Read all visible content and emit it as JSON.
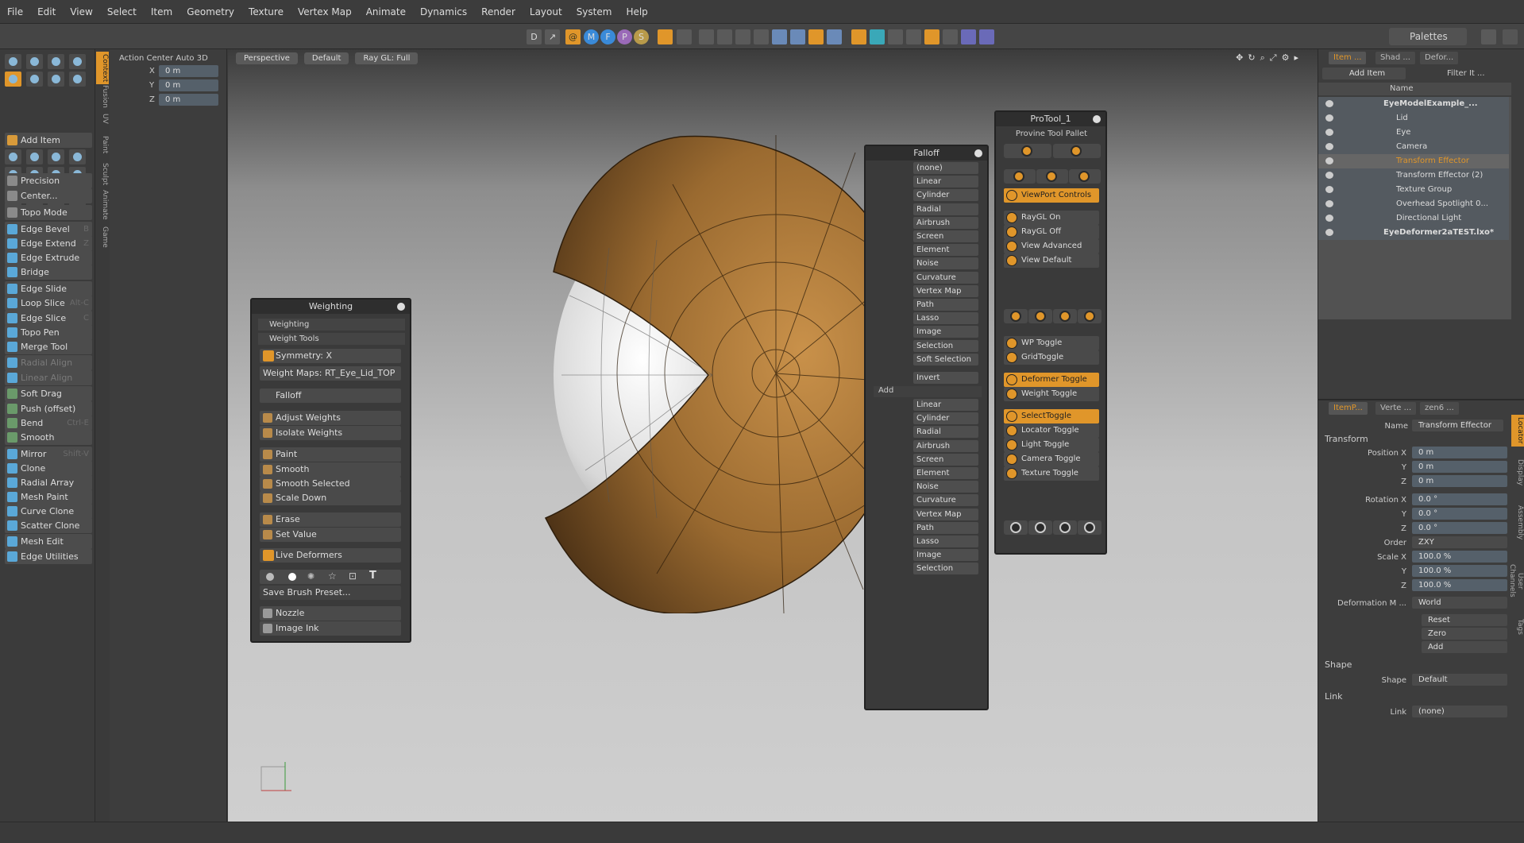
{
  "menu": [
    "File",
    "Edit",
    "View",
    "Select",
    "Item",
    "Geometry",
    "Texture",
    "Vertex Map",
    "Animate",
    "Dynamics",
    "Render",
    "Layout",
    "System",
    "Help"
  ],
  "topbar": {
    "palettes": "Palettes",
    "icons": [
      "D",
      "↗",
      "@",
      "M",
      "F",
      "P",
      "S"
    ]
  },
  "left_tools": {
    "add_item": "Add Item",
    "items": [
      {
        "label": "Precision",
        "shortcut": ""
      },
      {
        "label": "Center...",
        "shortcut": ""
      },
      {
        "label": "Topo Mode",
        "shortcut": ""
      },
      {
        "label": "Edge Bevel",
        "shortcut": "B"
      },
      {
        "label": "Edge Extend",
        "shortcut": "Z"
      },
      {
        "label": "Edge Extrude",
        "shortcut": ""
      },
      {
        "label": "Bridge",
        "shortcut": ""
      },
      {
        "label": "Edge Slide",
        "shortcut": ""
      },
      {
        "label": "Loop Slice",
        "shortcut": "Alt-C"
      },
      {
        "label": "Edge Slice",
        "shortcut": "C"
      },
      {
        "label": "Topo Pen",
        "shortcut": ""
      },
      {
        "label": "Merge Tool",
        "shortcut": ""
      },
      {
        "label": "Radial Align",
        "shortcut": ""
      },
      {
        "label": "Linear Align",
        "shortcut": ""
      },
      {
        "label": "Soft Drag",
        "shortcut": ""
      },
      {
        "label": "Push (offset)",
        "shortcut": ""
      },
      {
        "label": "Bend",
        "shortcut": "Ctrl-E"
      },
      {
        "label": "Smooth",
        "shortcut": ""
      },
      {
        "label": "Mirror",
        "shortcut": "Shift-V"
      },
      {
        "label": "Clone",
        "shortcut": ""
      },
      {
        "label": "Radial Array",
        "shortcut": ""
      },
      {
        "label": "Mesh Paint",
        "shortcut": ""
      },
      {
        "label": "Curve Clone",
        "shortcut": ""
      },
      {
        "label": "Scatter Clone",
        "shortcut": ""
      },
      {
        "label": "Mesh Edit",
        "shortcut": ""
      },
      {
        "label": "Edge Utilities",
        "shortcut": ""
      }
    ]
  },
  "vtabs": [
    "Context",
    "Fusion",
    "UV",
    "Paint",
    "Sculpt",
    "Animate",
    "Game"
  ],
  "action_center": {
    "title": "Action Center Auto 3D",
    "x_label": "X",
    "y_label": "Y",
    "z_label": "Z",
    "x": "0 m",
    "y": "0 m",
    "z": "0 m"
  },
  "viewport": {
    "tabs": [
      "Perspective",
      "Default",
      "Ray GL: Full"
    ]
  },
  "weighting": {
    "title": "Weighting",
    "sec1": "Weighting",
    "sec2": "Weight Tools",
    "symmetry": "Symmetry: X",
    "weight_maps": "Weight Maps: RT_Eye_Lid_TOP",
    "falloff": "Falloff",
    "b1": "Adjust Weights",
    "b2": "Isolate Weights",
    "b3": "Paint",
    "b4": "Smooth",
    "b5": "Smooth Selected",
    "b6": "Scale Down",
    "b7": "Erase",
    "b8": "Set Value",
    "live": "Live Deformers",
    "save": "Save Brush Preset...",
    "b9": "Nozzle",
    "b10": "Image Ink"
  },
  "falloff": {
    "title": "Falloff",
    "list1": [
      "(none)",
      "Linear",
      "Cylinder",
      "Radial",
      "Airbrush",
      "Screen",
      "Element",
      "Noise",
      "Curvature",
      "Vertex Map",
      "Path",
      "Lasso",
      "Image",
      "Selection",
      "Soft Selection"
    ],
    "invert": "Invert",
    "add": "Add",
    "list2": [
      "Linear",
      "Cylinder",
      "Radial",
      "Airbrush",
      "Screen",
      "Element",
      "Noise",
      "Curvature",
      "Vertex Map",
      "Path",
      "Lasso",
      "Image",
      "Selection"
    ]
  },
  "protool": {
    "title": "ProTool_1",
    "subtitle": "Provine  Tool  Pallet",
    "buttons": [
      {
        "label": "ViewPort Controls",
        "active": true
      },
      {
        "label": "RayGL On",
        "active": false
      },
      {
        "label": "RayGL Off",
        "active": false
      },
      {
        "label": "View Advanced",
        "active": false
      },
      {
        "label": "View Default",
        "active": false
      },
      {
        "label": "WP Toggle",
        "active": false
      },
      {
        "label": "GridToggle",
        "active": false
      },
      {
        "label": "Deformer Toggle",
        "active": true
      },
      {
        "label": "Weight Toggle",
        "active": false
      },
      {
        "label": "SelectToggle",
        "active": true
      },
      {
        "label": "Locator Toggle",
        "active": false
      },
      {
        "label": "Light Toggle",
        "active": false
      },
      {
        "label": "Camera Toggle",
        "active": false
      },
      {
        "label": "Texture Toggle",
        "active": false
      }
    ]
  },
  "items_panel": {
    "tabs": [
      "Item ...",
      "Shad ...",
      "Defor..."
    ],
    "add_item": "Add Item",
    "filter": "Filter It ...",
    "col_name": "Name",
    "tree": [
      {
        "label": "EyeModelExample_...",
        "indent": 0,
        "selected": false
      },
      {
        "label": "Lid",
        "indent": 2,
        "selected": false
      },
      {
        "label": "Eye",
        "indent": 2,
        "selected": false
      },
      {
        "label": "Camera",
        "indent": 2,
        "selected": false
      },
      {
        "label": "Transform Effector",
        "indent": 2,
        "selected": true
      },
      {
        "label": "Transform Effector (2)",
        "indent": 2,
        "selected": false
      },
      {
        "label": "Texture Group",
        "indent": 2,
        "selected": false
      },
      {
        "label": "Overhead Spotlight 0...",
        "indent": 2,
        "selected": false
      },
      {
        "label": "Directional Light",
        "indent": 2,
        "selected": false
      },
      {
        "label": "EyeDeformer2aTEST.lxo*",
        "indent": 0,
        "selected": false
      }
    ]
  },
  "properties": {
    "tabs": [
      "ItemP...",
      "Verte ...",
      "zen6 ..."
    ],
    "name_label": "Name",
    "name_value": "Transform Effector",
    "transform": "Transform",
    "position_label": "Position X",
    "pos_x": "0 m",
    "pos_y": "0 m",
    "pos_z": "0 m",
    "rotation_label": "Rotation X",
    "rot_x": "0.0 °",
    "rot_y": "0.0 °",
    "rot_z": "0.0 °",
    "order_label": "Order",
    "order": "ZXY",
    "scale_label": "Scale X",
    "scale_x": "100.0 %",
    "scale_y": "100.0 %",
    "scale_z": "100.0 %",
    "y_label": "Y",
    "z_label": "Z",
    "deform_label": "Deformation M ...",
    "deform": "World",
    "reset": "Reset",
    "zero": "Zero",
    "add": "Add",
    "shape_sec": "Shape",
    "shape_label": "Shape",
    "shape": "Default",
    "link_sec": "Link",
    "link_label": "Link",
    "link": "(none)",
    "side_tabs": [
      "Locator",
      "Display",
      "Assembly",
      "User Channels",
      "Tags"
    ]
  }
}
